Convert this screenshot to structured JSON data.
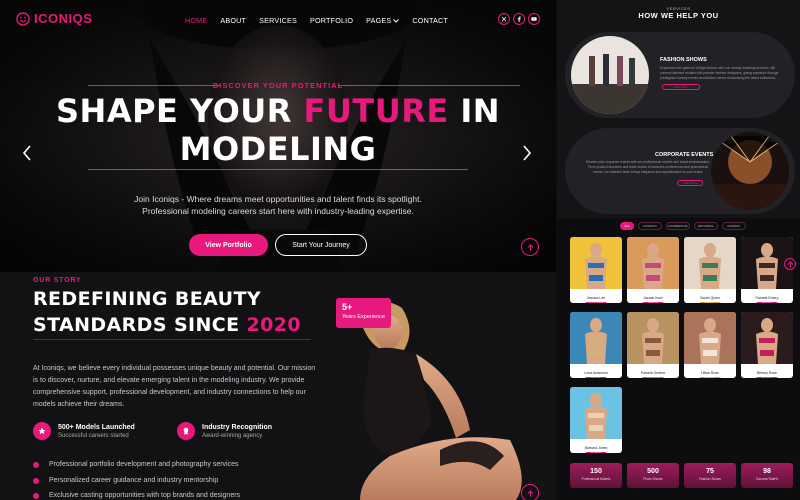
{
  "brand": {
    "name": "ICONIQS",
    "accent": "#e8197d"
  },
  "nav": {
    "links": [
      {
        "label": "HOME",
        "active": true
      },
      {
        "label": "ABOUT"
      },
      {
        "label": "SERVICES"
      },
      {
        "label": "PORTFOLIO"
      },
      {
        "label": "PAGES",
        "dropdown": true
      },
      {
        "label": "CONTACT"
      }
    ],
    "socials": [
      "x-icon",
      "facebook-icon",
      "youtube-icon"
    ]
  },
  "hero": {
    "eyebrow": "DISCOVER YOUR POTENTIAL",
    "title_1": "SHAPE YOUR ",
    "title_highlight": "FUTURE",
    "title_2": " IN",
    "title_3": "MODELING",
    "desc_1": "Join Iconiqs - Where dreams meet opportunities and talent finds its spotlight.",
    "desc_2": "Professional modeling careers start here with industry-leading expertise.",
    "primary_cta": "View Portfolio",
    "secondary_cta": "Start Your Journey"
  },
  "story": {
    "eyebrow": "OUR STORY",
    "title_1": "REDEFINING BEAUTY",
    "title_2": "STANDARDS SINCE ",
    "title_year": "2020",
    "body": "At Iconiqs, we believe every individual possesses unique beauty and potential. Our mission is to discover, nurture, and elevate emerging talent in the modeling industry. We provide comprehensive support, professional development, and industry connections to help our models achieve their dreams.",
    "stats": [
      {
        "title": "500+ Models Launched",
        "sub": "Successful careers started"
      },
      {
        "title": "Industry Recognition",
        "sub": "Award-winning agency"
      }
    ],
    "bullets": [
      "Professional portfolio development and photography services",
      "Personalized career guidance and industry mentorship",
      "Exclusive casting opportunities with top brands and designers"
    ],
    "experience_num": "5+",
    "experience_label": "Years Experience"
  },
  "services": {
    "eyebrow": "SERVICES",
    "title": "HOW WE HELP YOU",
    "items": [
      {
        "name": "FASHION SHOWS",
        "text": "Experience the glamour of high fashion with our runway modeling services. We connect talented models with premier fashion designers, giving exposure through prestigious runway events and fashion weeks showcasing the latest collections.",
        "cta": "Learn More"
      },
      {
        "name": "CORPORATE EVENTS",
        "text": "Elevate your corporate events with our professional models and brand ambassadors. From product launches and trade shows to business conferences and promotional events, our talented team brings elegance and sophistication to your brand.",
        "cta": "Learn More"
      }
    ]
  },
  "models": {
    "filters": [
      "ALL",
      "FASHION",
      "COMMERCIAL",
      "EDITORIAL",
      "RUNWAY"
    ],
    "cards": [
      {
        "name": "Jessica Lee",
        "tag": "Commercial",
        "tag_color": "#e8197d"
      },
      {
        "name": "Jasmin Irwin",
        "tag": "Editorial",
        "tag_color": "#e8197d"
      },
      {
        "name": "Sarah Quinn",
        "tag": "Fashion",
        "tag_color": "#d6a21e"
      },
      {
        "name": "Pamela Emery",
        "tag": "Runway",
        "tag_color": "#e8197d"
      },
      {
        "name": "Luna Anderson",
        "tag": "Runway",
        "tag_color": "#e8197d"
      },
      {
        "name": "Pamela Greene",
        "tag": "Commercial",
        "tag_color": "#1f9d57"
      },
      {
        "name": "Lillian Rose",
        "tag": "Fashion",
        "tag_color": "#d6a21e"
      },
      {
        "name": "Britney Rose",
        "tag": "Runway",
        "tag_color": "#e8197d"
      },
      {
        "name": "Barbara Jones",
        "tag": "Fashion",
        "tag_color": "#e8197d"
      }
    ],
    "counters": [
      {
        "num": "150",
        "label": "Professional Models"
      },
      {
        "num": "500",
        "label": "Photo Shoots"
      },
      {
        "num": "75",
        "label": "Fashion Shows"
      },
      {
        "num": "98",
        "label": "Success Rate%"
      }
    ]
  }
}
